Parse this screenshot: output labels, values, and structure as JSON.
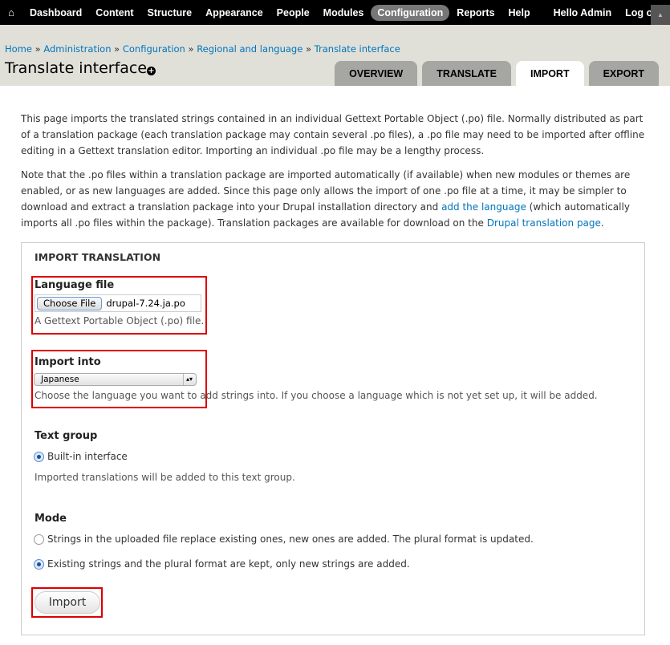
{
  "toolbar": {
    "home_icon": "home-icon",
    "items": [
      "Dashboard",
      "Content",
      "Structure",
      "Appearance",
      "People",
      "Modules",
      "Configuration",
      "Reports",
      "Help"
    ],
    "active": "Configuration",
    "hello": "Hello",
    "user": "Admin",
    "logout": "Log out"
  },
  "breadcrumb": [
    "Home",
    "Administration",
    "Configuration",
    "Regional and language",
    "Translate interface"
  ],
  "breadcrumb_sep": "»",
  "page_title": "Translate interface",
  "tabs": [
    "OVERVIEW",
    "TRANSLATE",
    "IMPORT",
    "EXPORT"
  ],
  "active_tab": "IMPORT",
  "intro": {
    "p1": "This page imports the translated strings contained in an individual Gettext Portable Object (.po) file. Normally distributed as part of a translation package (each translation package may contain several .po files), a .po file may need to be imported after offline editing in a Gettext translation editor. Importing an individual .po file may be a lengthy process.",
    "p2a": "Note that the .po files within a translation package are imported automatically (if available) when new modules or themes are enabled, or as new languages are added. Since this page only allows the import of one .po file at a time, it may be simpler to download and extract a translation package into your Drupal installation directory and ",
    "p2_link1": "add the language",
    "p2b": " (which automatically imports all .po files within the package). Translation packages are available for download on the ",
    "p2_link2": "Drupal translation page",
    "p2c": "."
  },
  "form": {
    "legend": "IMPORT TRANSLATION",
    "file_label": "Language file",
    "choose_file": "Choose File",
    "file_value": "drupal-7.24.ja.po",
    "file_desc": "A Gettext Portable Object (.po) file.",
    "import_into_label": "Import into",
    "import_into_value": "Japanese",
    "import_into_desc": "Choose the language you want to add strings into. If you choose a language which is not yet set up, it will be added.",
    "group_label": "Text group",
    "group_option": "Built-in interface",
    "group_desc": "Imported translations will be added to this text group.",
    "mode_label": "Mode",
    "mode_options": [
      "Strings in the uploaded file replace existing ones, new ones are added. The plural format is updated.",
      "Existing strings and the plural format are kept, only new strings are added."
    ],
    "mode_selected": 1,
    "submit": "Import"
  },
  "highlight_color": "#dd0000"
}
